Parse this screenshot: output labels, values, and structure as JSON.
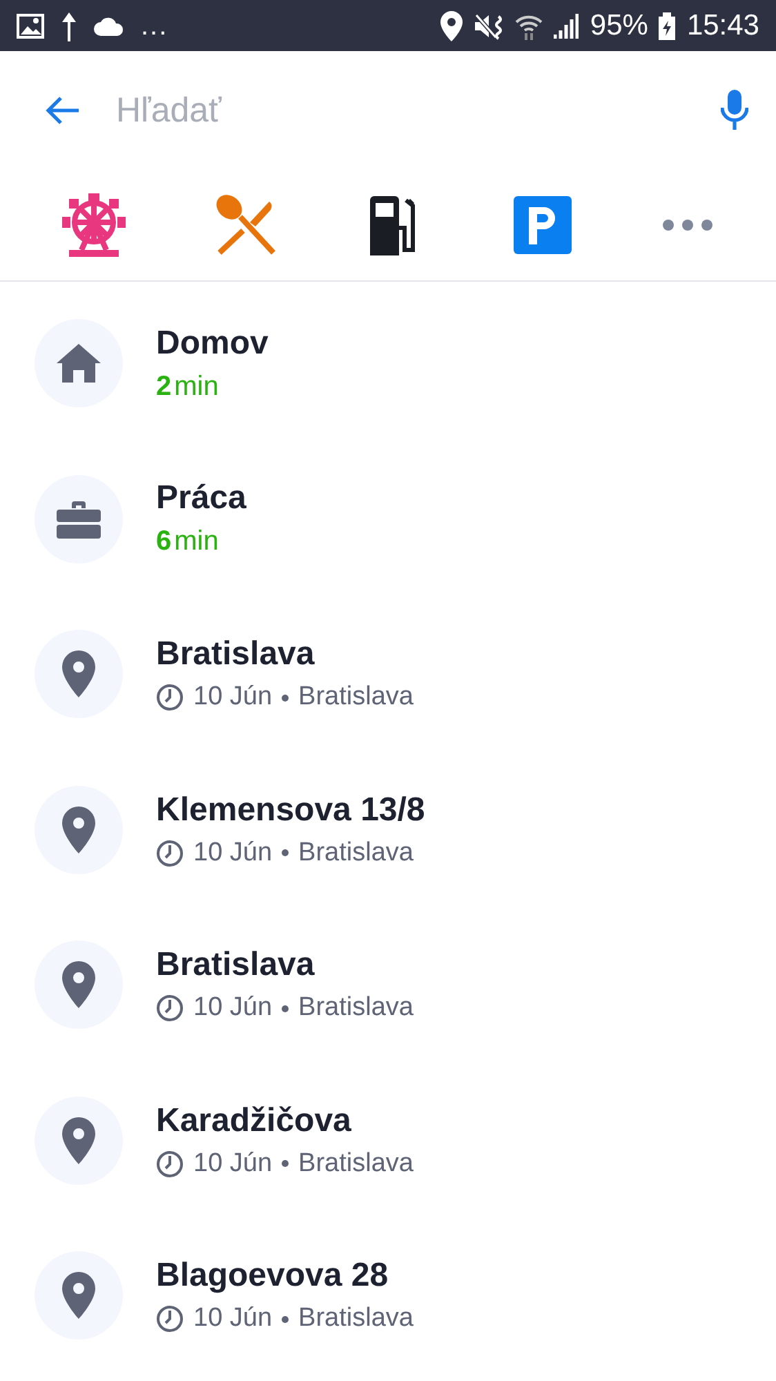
{
  "status_bar": {
    "overflow": "...",
    "battery": "95%",
    "time": "15:43"
  },
  "search": {
    "placeholder": "Hľadať"
  },
  "categories": [
    {
      "kind": "attractions"
    },
    {
      "kind": "restaurant"
    },
    {
      "kind": "fuel"
    },
    {
      "kind": "parking"
    },
    {
      "kind": "more"
    }
  ],
  "places": [
    {
      "kind": "home",
      "title": "Domov",
      "eta": "**2**min"
    },
    {
      "kind": "work",
      "title": "Práca",
      "eta": "**6**min"
    },
    {
      "kind": "history",
      "title": "Bratislava",
      "date": "10 Jún",
      "location": "Bratislava"
    },
    {
      "kind": "history",
      "title": "Klemensova 13/8",
      "date": "10 Jún",
      "location": "Bratislava"
    },
    {
      "kind": "history",
      "title": "Bratislava",
      "date": "10 Jún",
      "location": "Bratislava"
    },
    {
      "kind": "history",
      "title": "Karadžičova",
      "date": "10 Jún",
      "location": "Bratislava"
    },
    {
      "kind": "history",
      "title": "Blagoevova 28",
      "date": "10 Jún",
      "location": "Bratislava"
    }
  ]
}
